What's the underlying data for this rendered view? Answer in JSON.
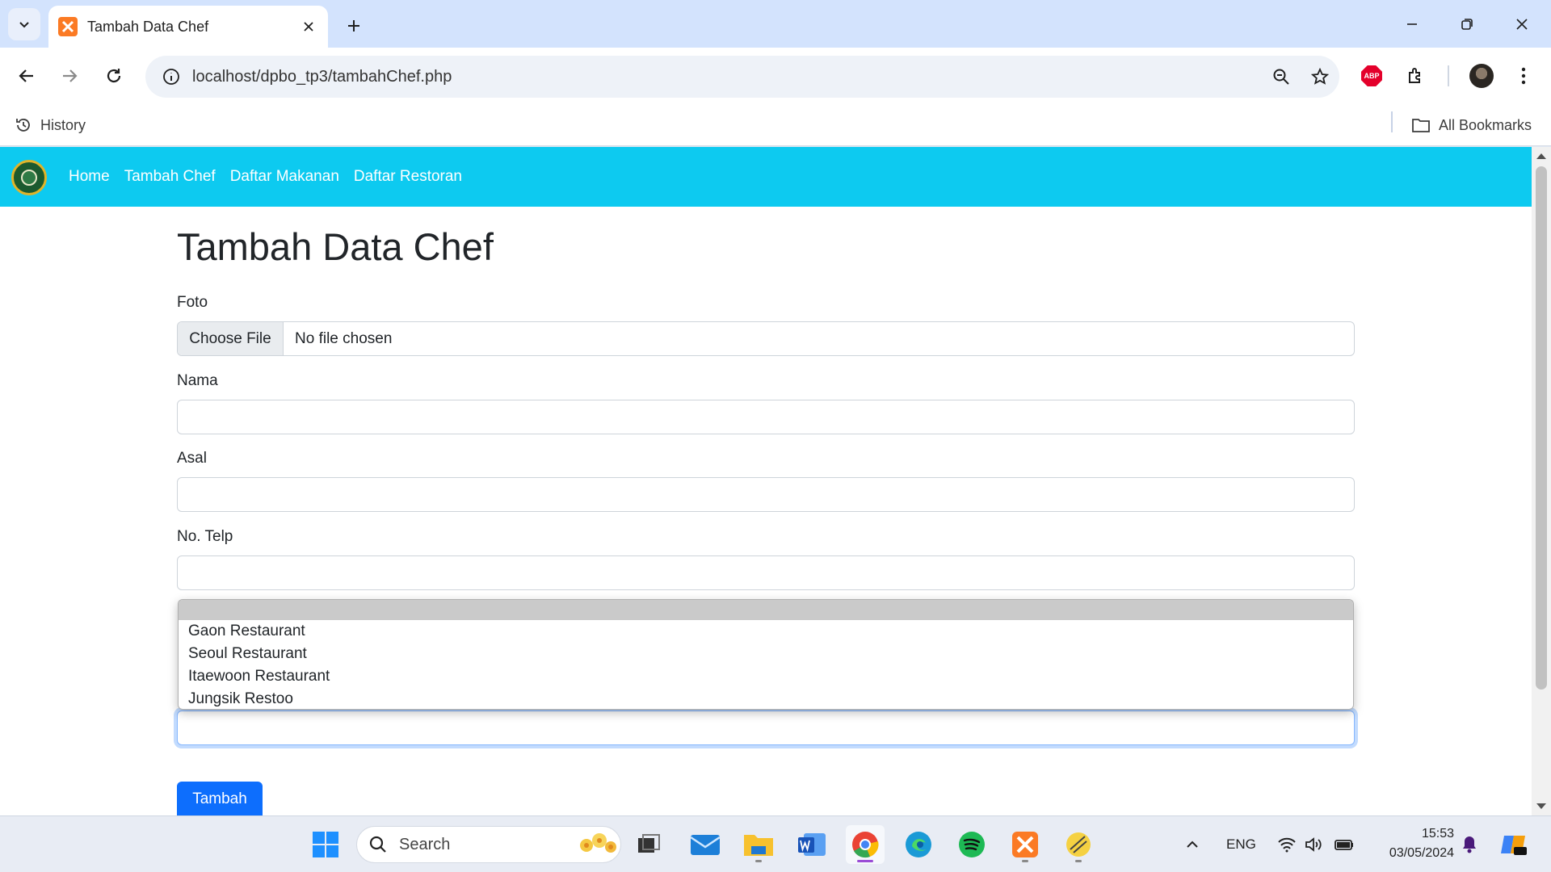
{
  "browser": {
    "tab_title": "Tambah Data Chef",
    "url": "localhost/dpbo_tp3/tambahChef.php",
    "bookmarks": {
      "history": "History",
      "all_bookmarks": "All Bookmarks"
    },
    "abp_label": "ABP"
  },
  "site": {
    "nav": [
      "Home",
      "Tambah Chef",
      "Daftar Makanan",
      "Daftar Restoran"
    ],
    "page_title": "Tambah Data Chef",
    "form": {
      "foto_label": "Foto",
      "choose_file": "Choose File",
      "no_file": "No file chosen",
      "nama_label": "Nama",
      "nama_value": "",
      "asal_label": "Asal",
      "asal_value": "",
      "telp_label": "No. Telp",
      "telp_value": "",
      "restoran_options": [
        "",
        "Gaon Restaurant",
        "Seoul Restaurant",
        "Itaewoon Restaurant",
        "Jungsik Restoo"
      ],
      "last_value": "",
      "submit": "Tambah"
    }
  },
  "taskbar": {
    "search_placeholder": "Search",
    "language": "ENG",
    "time": "15:53",
    "date": "03/05/2024",
    "apps": [
      "windows-start",
      "search",
      "task-view",
      "mail",
      "file-explorer",
      "word",
      "chrome",
      "edge",
      "spotify",
      "xampp",
      "other-app"
    ]
  },
  "colors": {
    "site_nav": "#0dcaf0",
    "submit_button": "#0d6efd",
    "tab_strip": "#d3e3fd"
  }
}
